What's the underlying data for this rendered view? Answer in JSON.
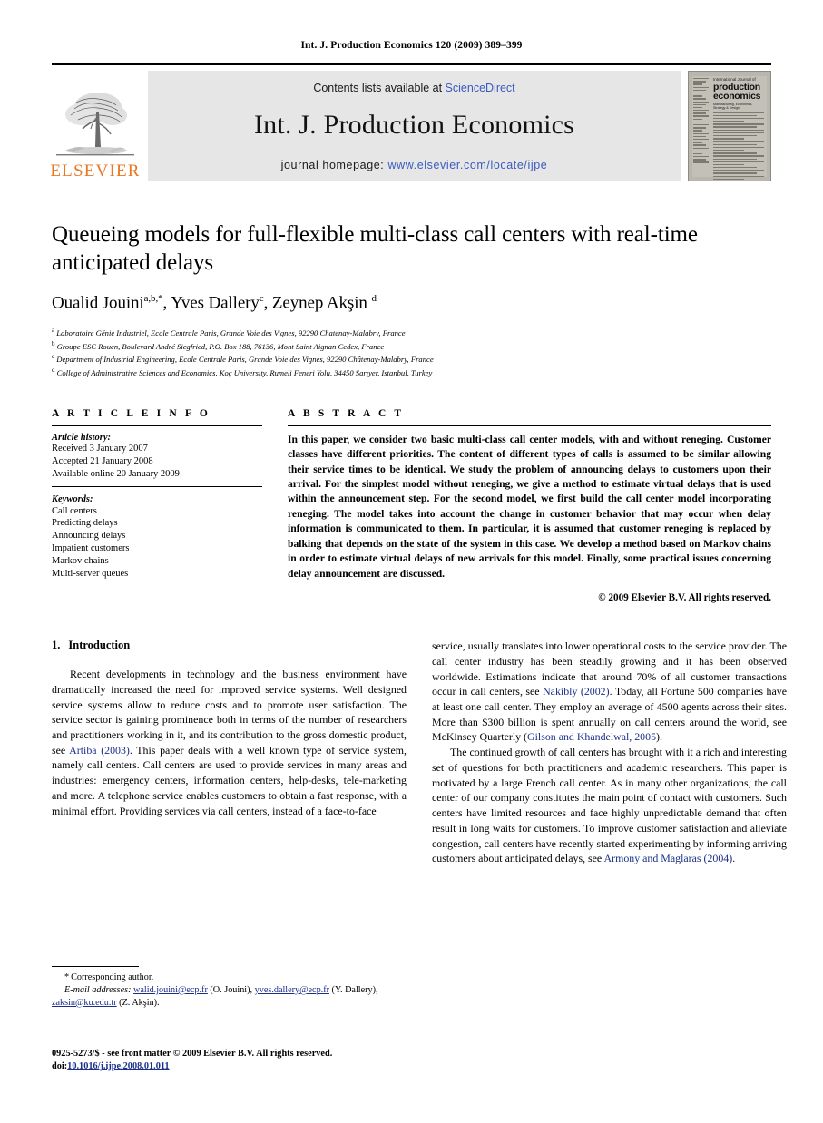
{
  "running_head": "Int. J. Production Economics 120 (2009) 389–399",
  "banner": {
    "publisher_wordmark": "ELSEVIER",
    "contents_prefix": "Contents lists available at ",
    "contents_link": "ScienceDirect",
    "journal_title": "Int. J. Production Economics",
    "homepage_prefix": "journal homepage: ",
    "homepage_url": "www.elsevier.com/locate/ijpe",
    "cover": {
      "line1": "International Journal of",
      "line2": "production",
      "line3": "economics",
      "subtitle": "Manufacturing, Economics, Strategy & Design"
    }
  },
  "article": {
    "title": "Queueing models for full-flexible multi-class call centers with real-time anticipated delays",
    "authors": [
      {
        "name": "Oualid Jouini",
        "marks": "a,b,*"
      },
      {
        "name": "Yves Dallery",
        "marks": "c"
      },
      {
        "name": "Zeynep Akşin",
        "marks": "d"
      }
    ],
    "affiliations": [
      {
        "mark": "a",
        "text": "Laboratoire Génie Industriel, Ecole Centrale Paris, Grande Voie des Vignes, 92290 Chatenay-Malabry, France"
      },
      {
        "mark": "b",
        "text": "Groupe ESC Rouen, Boulevard André Siegfried, P.O. Box 188, 76136, Mont Saint Aignan Cedex, France"
      },
      {
        "mark": "c",
        "text": "Department of Industrial Engineering, Ecole Centrale Paris, Grande Voie des Vignes, 92290 Châtenay-Malabry, France"
      },
      {
        "mark": "d",
        "text": "College of Administrative Sciences and Economics, Koç University, Rumeli Feneri Yolu, 34450 Sarıyer, Istanbul, Turkey"
      }
    ]
  },
  "article_info": {
    "heading": "A R T I C L E   I N F O",
    "history_label": "Article history:",
    "history": [
      "Received 3 January 2007",
      "Accepted 21 January 2008",
      "Available online 20 January 2009"
    ],
    "keywords_label": "Keywords:",
    "keywords": [
      "Call centers",
      "Predicting delays",
      "Announcing delays",
      "Impatient customers",
      "Markov chains",
      "Multi-server queues"
    ]
  },
  "abstract": {
    "heading": "A B S T R A C T",
    "text": "In this paper, we consider two basic multi-class call center models, with and without reneging. Customer classes have different priorities. The content of different types of calls is assumed to be similar allowing their service times to be identical. We study the problem of announcing delays to customers upon their arrival. For the simplest model without reneging, we give a method to estimate virtual delays that is used within the announcement step. For the second model, we first build the call center model incorporating reneging. The model takes into account the change in customer behavior that may occur when delay information is communicated to them. In particular, it is assumed that customer reneging is replaced by balking that depends on the state of the system in this case. We develop a method based on Markov chains in order to estimate virtual delays of new arrivals for this model. Finally, some practical issues concerning delay announcement are discussed.",
    "copyright": "© 2009 Elsevier B.V. All rights reserved."
  },
  "body": {
    "section_number": "1.",
    "section_title": "Introduction",
    "left_paragraph": {
      "part1": "Recent developments in technology and the business environment have dramatically increased the need for improved service systems. Well designed service systems allow to reduce costs and to promote user satisfaction. The service sector is gaining prominence both in terms of the number of researchers and practitioners working in it, and its contribution to the gross domestic product, see ",
      "link1": "Artiba (2003)",
      "part2": ". This paper deals with a well known type of service system, namely call centers. Call centers are used to provide services in many areas and industries: emergency centers, information centers, help-desks, tele-marketing and more. A telephone service enables customers to obtain a fast response, with a minimal effort. Providing services via call centers, instead of a face-to-face"
    },
    "right_paragraph_1": {
      "part1": "service, usually translates into lower operational costs to the service provider. The call center industry has been steadily growing and it has been observed worldwide. Estimations indicate that around 70% of all customer transactions occur in call centers, see ",
      "link1": "Nakibly (2002)",
      "part2": ". Today, all Fortune 500 companies have at least one call center. They employ an average of 4500 agents across their sites. More than $300 billion is spent annually on call centers around the world, see McKinsey Quarterly (",
      "link2": "Gilson and Khandelwal, 2005",
      "part3": ")."
    },
    "right_paragraph_2": {
      "part1": "The continued growth of call centers has brought with it a rich and interesting set of questions for both practitioners and academic researchers. This paper is motivated by a large French call center. As in many other organizations, the call center of our company constitutes the main point of contact with customers. Such centers have limited resources and face highly unpredictable demand that often result in long waits for customers. To improve customer satisfaction and alleviate congestion, call centers have recently started experimenting by informing arriving customers about anticipated delays, see ",
      "link1": "Armony and Maglaras (2004)",
      "part2": "."
    }
  },
  "footnote": {
    "corresponding": "Corresponding author.",
    "email_label": "E-mail addresses:",
    "email_1": "walid.jouini@ecp.fr",
    "email_1_owner": " (O. Jouini), ",
    "email_2": "yves.dallery@ecp.fr",
    "email_2_owner": " (Y. Dallery), ",
    "email_3": "zaksin@ku.edu.tr",
    "email_3_owner": " (Z. Akşin)."
  },
  "imprint": {
    "issn_line": "0925-5273/$ - see front matter © 2009 Elsevier B.V. All rights reserved.",
    "doi_prefix": "doi:",
    "doi": "10.1016/j.ijpe.2008.01.011"
  },
  "colors": {
    "link": "#1b2f8a",
    "banner_link": "#3b5bbf",
    "elsevier_orange": "#E87722",
    "banner_bg": "#e6e6e6"
  }
}
